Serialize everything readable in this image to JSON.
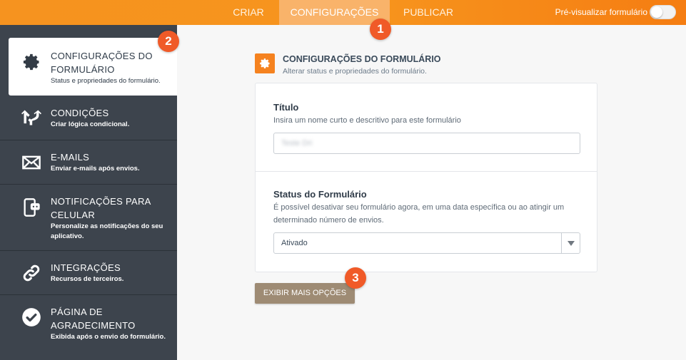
{
  "topbar": {
    "tabs": [
      {
        "label": "CRIAR"
      },
      {
        "label": "CONFIGURAÇÕES"
      },
      {
        "label": "PUBLICAR"
      }
    ],
    "active_tab": "CONFIGURAÇÕES",
    "preview_label": "Pré-visualizar formulário",
    "preview_toggle": false
  },
  "badges": [
    "1",
    "2",
    "3"
  ],
  "sidebar": {
    "items": [
      {
        "title": "CONFIGURAÇÕES DO FORMULÁRIO",
        "desc": "Status e propriedades do formulário.",
        "icon": "gear-icon",
        "active": true
      },
      {
        "title": "CONDIÇÕES",
        "desc": "Criar lógica condicional.",
        "icon": "conditions-icon"
      },
      {
        "title": "E-MAILS",
        "desc": "Enviar e-mails após envios.",
        "icon": "envelope-icon"
      },
      {
        "title": "NOTIFICAÇÕES PARA CELULAR",
        "desc": "Personalize as notificações do seu aplicativo.",
        "icon": "mobile-notification-icon"
      },
      {
        "title": "INTEGRAÇÕES",
        "desc": "Recursos de terceiros.",
        "icon": "link-icon"
      },
      {
        "title": "PÁGINA DE AGRADECIMENTO",
        "desc": "Exibida após o envio do formulário.",
        "icon": "check-circle-icon"
      }
    ]
  },
  "main": {
    "section_title": "CONFIGURAÇÕES DO FORMULÁRIO",
    "section_subtitle": "Alterar status e propriedades do formulário.",
    "title_field": {
      "label": "Título",
      "help": "Insira um nome curto e descritivo para este formulário",
      "value": "Teste Dri"
    },
    "status_field": {
      "label": "Status do Formulário",
      "help": "É possível desativar seu formulário agora, em uma data específica ou ao atingir um determinado número de envios.",
      "value": "Ativado"
    },
    "more_button": "EXIBIR MAIS OPÇÕES"
  },
  "colors": {
    "accent": "#f7941d",
    "sidebar": "#3d444d",
    "badge": "#f05a28",
    "more_button": "#9e8b74"
  }
}
